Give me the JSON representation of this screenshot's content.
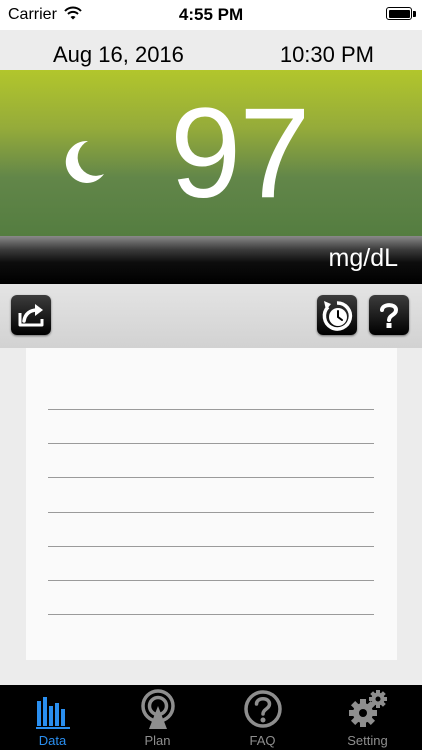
{
  "status_bar": {
    "carrier": "Carrier",
    "time": "4:55 PM",
    "icons": [
      "wifi-icon",
      "battery-icon"
    ]
  },
  "reading": {
    "date": "Aug 16, 2016",
    "time": "10:30 PM",
    "value": "97",
    "unit": "mg/dL",
    "period_icon": "moon-icon"
  },
  "toolbar": {
    "buttons": [
      {
        "icon": "share-icon"
      },
      {
        "icon": "history-icon"
      },
      {
        "icon": "help-icon"
      }
    ]
  },
  "notes": {
    "line_count": 7
  },
  "tabs": [
    {
      "label": "Data",
      "icon": "bar-chart-icon",
      "active": true
    },
    {
      "label": "Plan",
      "icon": "plan-icon",
      "active": false
    },
    {
      "label": "FAQ",
      "icon": "faq-icon",
      "active": false
    },
    {
      "label": "Setting",
      "icon": "gears-icon",
      "active": false
    }
  ],
  "colors": {
    "reading_panel_top": "#b2c62c",
    "reading_panel_bottom": "#547d40",
    "active_tab": "#2a8ff0",
    "inactive_tab": "#8e8e8e"
  }
}
